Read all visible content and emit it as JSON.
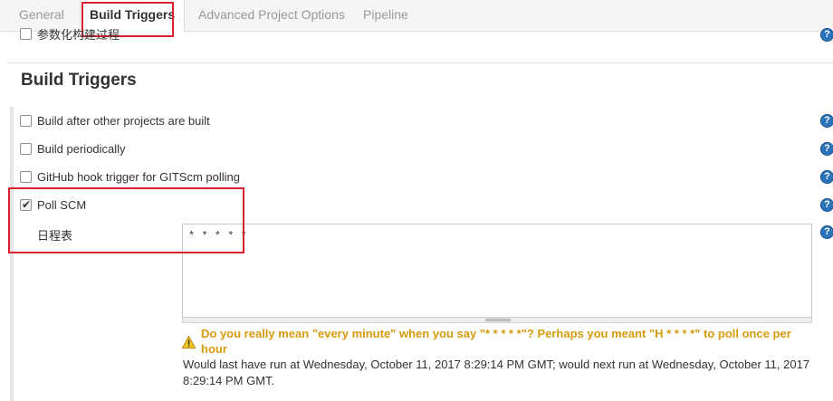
{
  "tabs": [
    {
      "label": "General"
    },
    {
      "label": "Build Triggers"
    },
    {
      "label": "Advanced Project Options"
    },
    {
      "label": "Pipeline"
    }
  ],
  "top_option": {
    "label": "参数化构建过程",
    "checked": false
  },
  "section": {
    "title": "Build Triggers"
  },
  "triggers": [
    {
      "label": "Build after other projects are built",
      "checked": false
    },
    {
      "label": "Build periodically",
      "checked": false
    },
    {
      "label": "GitHub hook trigger for GITScm polling",
      "checked": false
    },
    {
      "label": "Poll SCM",
      "checked": true
    }
  ],
  "schedule": {
    "label": "日程表",
    "value": "* * * * *",
    "warning": "Do you really mean \"every minute\" when you say \"* * * * *\"? Perhaps you meant \"H * * * *\" to poll once per hour",
    "info": "Would last have run at Wednesday, October 11, 2017 8:29:14 PM GMT; would next run at Wednesday, October 11, 2017 8:29:14 PM GMT."
  },
  "icons": {
    "help": "help-icon",
    "warning": "warning-icon",
    "check": "checkmark-icon"
  },
  "colors": {
    "help_blue": "#2a73b9",
    "warning": "#d69a0c",
    "annotation_red": "#d9202c"
  },
  "help_glyph": "?"
}
